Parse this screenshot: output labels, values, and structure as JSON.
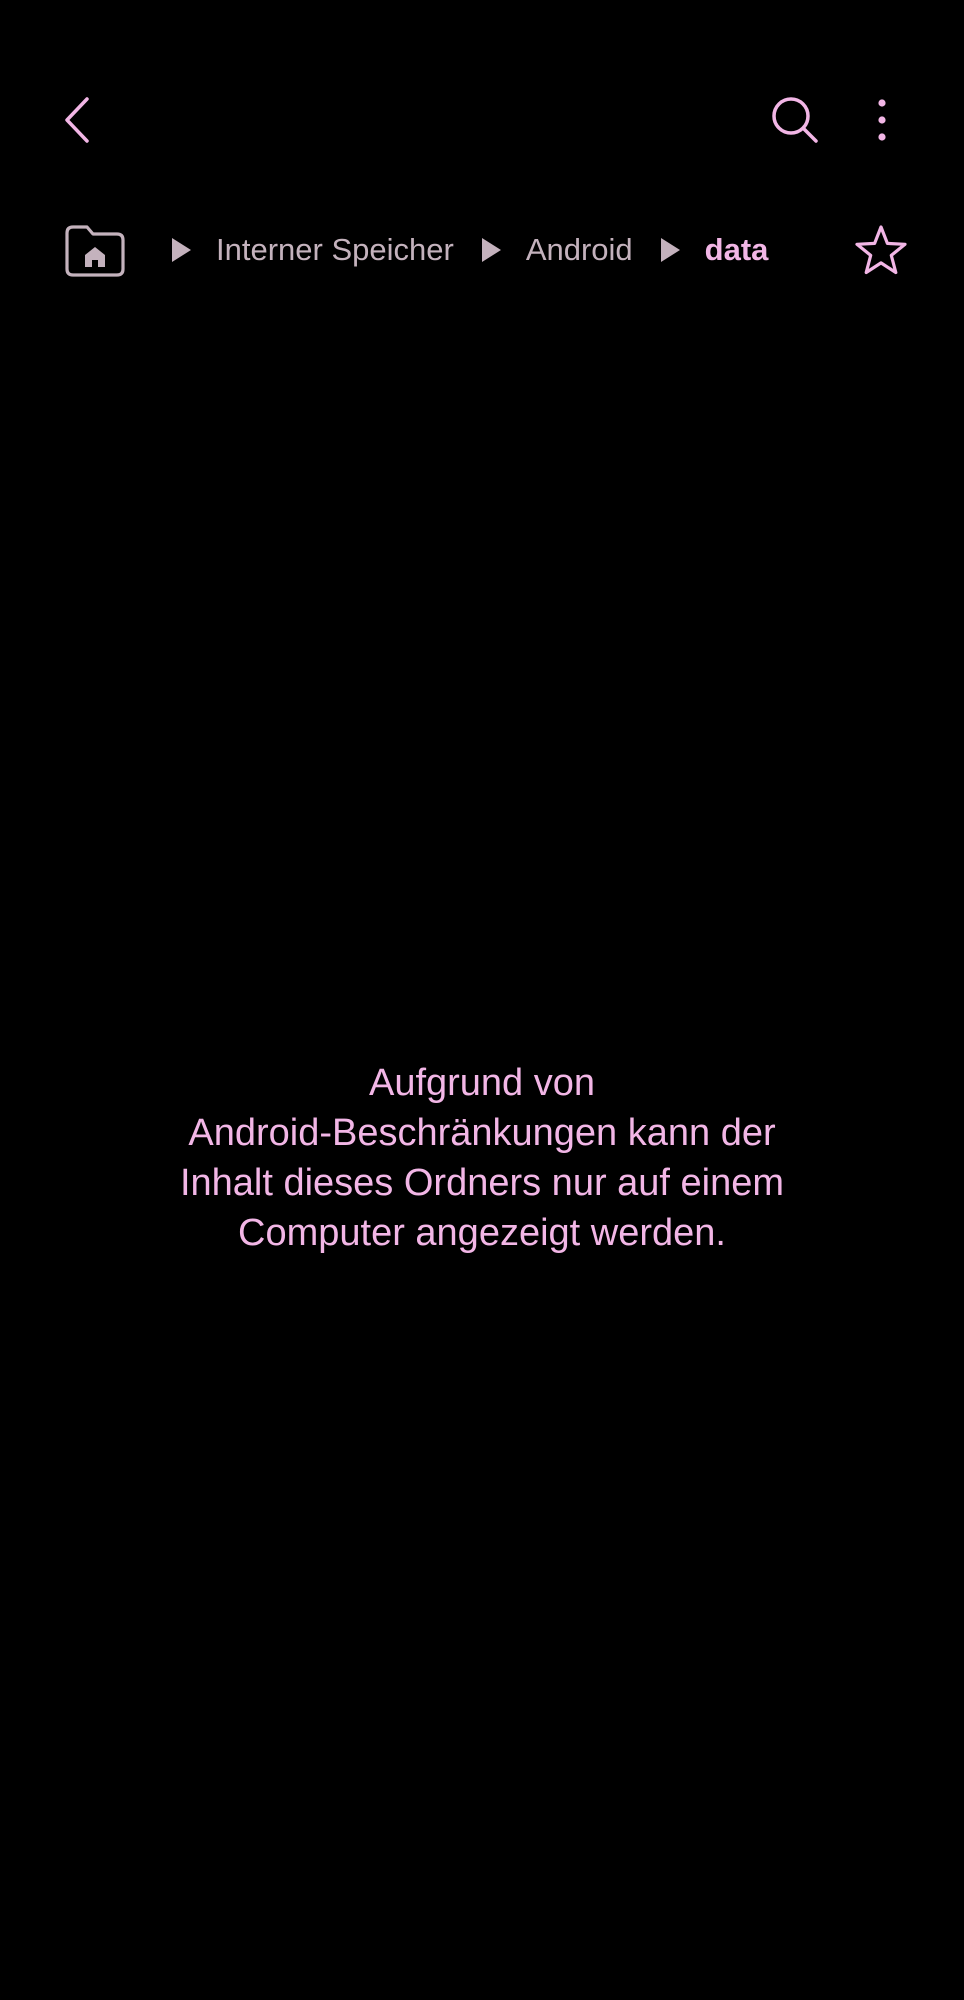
{
  "colors": {
    "background": "#000000",
    "accent": "#f2b6e6",
    "muted": "#c4b2bd"
  },
  "toolbar": {
    "back_icon": "chevron-left-icon",
    "search_icon": "search-icon",
    "more_icon": "more-vertical-icon"
  },
  "breadcrumb": {
    "home_icon": "home-folder-icon",
    "items": [
      {
        "label": "Interner Speicher"
      },
      {
        "label": "Android"
      }
    ],
    "current": "data",
    "favorite_icon": "star-outline-icon"
  },
  "message": {
    "lines": [
      "Aufgrund von",
      "Android-Beschränkungen kann der",
      "Inhalt dieses Ordners nur auf einem",
      "Computer angezeigt werden."
    ]
  }
}
